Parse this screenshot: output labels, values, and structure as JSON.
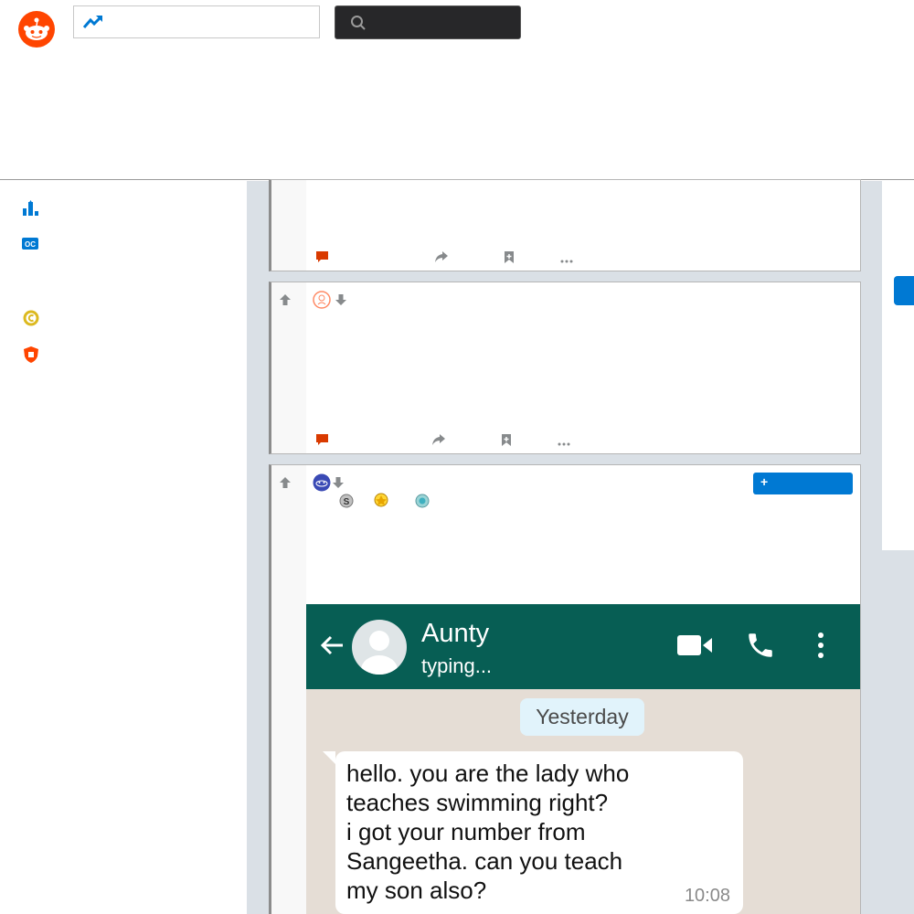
{
  "header": {
    "logo_icon": "reddit-logo-icon",
    "feed_icon": "trending-icon",
    "search_icon": "search-icon"
  },
  "sidebar": {
    "items": [
      {
        "icon": "leaderboard-icon",
        "color": "#0079d3"
      },
      {
        "icon": "oc-icon",
        "color": "#0079d3"
      },
      {
        "icon": "coins-icon",
        "color": "#dcb91f"
      },
      {
        "icon": "premium-shield-icon",
        "color": "#ff4500"
      }
    ]
  },
  "posts": [
    {
      "actions": [
        "comment-icon",
        "share-icon",
        "save-icon",
        "more-icon"
      ]
    },
    {
      "avatar_icon": "user-avatar-icon",
      "actions": [
        "comment-icon",
        "share-icon",
        "save-icon",
        "more-icon"
      ]
    },
    {
      "avatar_icon": "user-avatar-icon",
      "awards": [
        "silver-award-icon",
        "gold-award-icon",
        "platinum-award-icon"
      ],
      "join_label": "+",
      "image": {
        "contact_name": "Aunty",
        "contact_status": "typing...",
        "date_chip": "Yesterday",
        "message_lines": [
          "hello. you are the lady who",
          "teaches swimming right?",
          "i got your number from",
          "Sangeetha. can you teach",
          "my son also?"
        ],
        "message_time": "10:08"
      }
    }
  ],
  "colors": {
    "brand": "#ff4500",
    "accent": "#0079d3",
    "whatsapp_bar": "#075e54",
    "chat_bg": "#e5ddd5"
  }
}
